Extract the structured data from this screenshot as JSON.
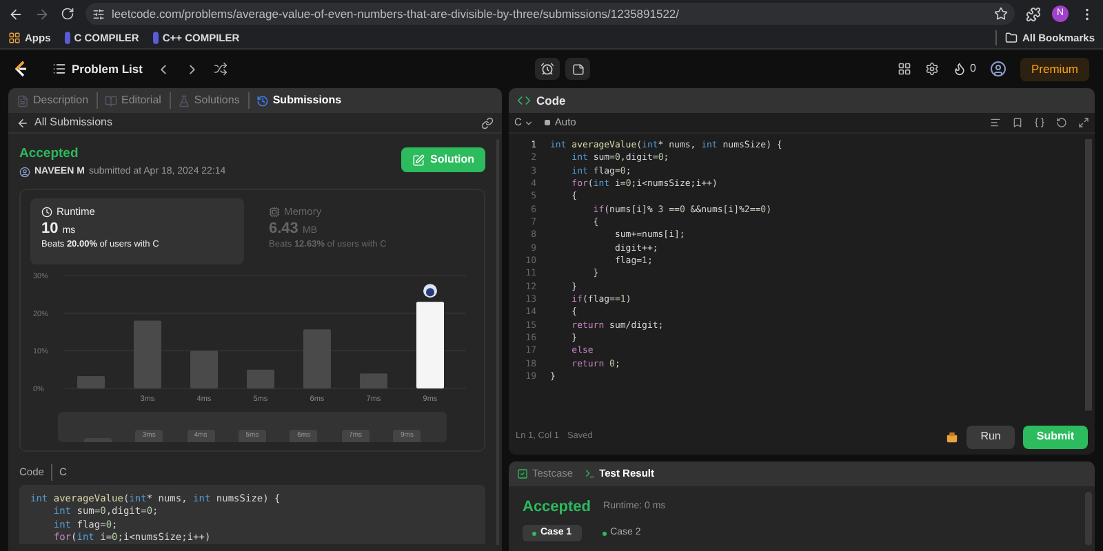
{
  "browser": {
    "url": "leetcode.com/problems/average-value-of-even-numbers-that-are-divisible-by-three/submissions/1235891522/",
    "bookmarks": [
      {
        "label": "Apps",
        "kind": "apps"
      },
      {
        "label": "C COMPILER",
        "kind": "link"
      },
      {
        "label": "C++ COMPILER",
        "kind": "link"
      }
    ],
    "all_bookmarks": "All Bookmarks",
    "profile_initial": "N"
  },
  "nav": {
    "problem_list": "Problem List",
    "streak": "0",
    "premium": "Premium"
  },
  "left_panel": {
    "tabs": [
      {
        "label": "Description",
        "selected": false
      },
      {
        "label": "Editorial",
        "selected": false
      },
      {
        "label": "Solutions",
        "selected": false
      },
      {
        "label": "Submissions",
        "selected": true
      }
    ],
    "back_link": "All Submissions",
    "submission": {
      "status": "Accepted",
      "user": "NAVEEN M",
      "submitted": "submitted at Apr 18, 2024 22:14",
      "solution_button": "Solution"
    },
    "stats": [
      {
        "kind": "runtime",
        "label": "Runtime",
        "value": "10",
        "unit": "ms",
        "beats": "Beats **20.00%** of users with C",
        "selected": true
      },
      {
        "kind": "memory",
        "label": "Memory",
        "value": "6.43",
        "unit": "MB",
        "beats": "Beats **12.63%** of users with C",
        "selected": false
      }
    ],
    "chart_data": {
      "type": "bar",
      "categories": [
        null,
        "3ms",
        "4ms",
        "5ms",
        "6ms",
        "7ms",
        "9ms"
      ],
      "series": [
        {
          "color": "#4a4a4a",
          "values": [
            3.3,
            18,
            10,
            5,
            15.7,
            4,
            null
          ]
        },
        {
          "color": "#f5f5f5",
          "values": [
            null,
            null,
            null,
            null,
            null,
            null,
            23
          ]
        }
      ],
      "ylim": [
        0,
        30
      ],
      "yticks": [
        {
          "value": 0,
          "label": "0%"
        },
        {
          "value": 10,
          "label": "10%"
        },
        {
          "value": 20,
          "label": "20%"
        },
        {
          "value": 30,
          "label": "30%"
        }
      ]
    },
    "range_labels": [
      "3ms",
      "4ms",
      "5ms",
      "6ms",
      "7ms",
      "9ms"
    ],
    "code_label": "Code",
    "code_language": "C",
    "code_lines": [
      [
        {
          "text": "int",
          "kind": "kw"
        },
        {
          "text": " averageValue",
          "kind": "fn"
        },
        {
          "text": "(",
          "kind": "p"
        },
        {
          "text": "int",
          "kind": "kw"
        },
        {
          "text": "* nums, ",
          "kind": "p"
        },
        {
          "text": "int",
          "kind": "kw"
        },
        {
          "text": " numsSize) {",
          "kind": "p"
        }
      ],
      [
        {
          "text": "    int",
          "kind": "kw"
        },
        {
          "text": " sum=",
          "kind": "p"
        },
        {
          "text": "0",
          "kind": "num"
        },
        {
          "text": ",digit=",
          "kind": "p"
        },
        {
          "text": "0",
          "kind": "num"
        },
        {
          "text": ";",
          "kind": "p"
        }
      ],
      [
        {
          "text": "    int",
          "kind": "kw"
        },
        {
          "text": " flag=",
          "kind": "p"
        },
        {
          "text": "0",
          "kind": "num"
        },
        {
          "text": ";",
          "kind": "p"
        }
      ],
      [
        {
          "text": "    for",
          "kind": "ctl"
        },
        {
          "text": "(",
          "kind": "p"
        },
        {
          "text": "int",
          "kind": "kw"
        },
        {
          "text": " i=",
          "kind": "p"
        },
        {
          "text": "0",
          "kind": "num"
        },
        {
          "text": ";i<numsSize;i++)",
          "kind": "p"
        }
      ]
    ]
  },
  "editor": {
    "title": "Code",
    "language": "C",
    "mode": "Auto",
    "lines": [
      {
        "number": "1",
        "tokens": [
          {
            "text": "int",
            "kind": "kw"
          },
          {
            "text": " averageValue",
            "kind": "fn"
          },
          {
            "text": "(",
            "kind": "p"
          },
          {
            "text": "int",
            "kind": "kw"
          },
          {
            "text": "* nums, ",
            "kind": "p"
          },
          {
            "text": "int",
            "kind": "kw"
          },
          {
            "text": " numsSize) {",
            "kind": "p"
          }
        ]
      },
      {
        "number": "2",
        "tokens": [
          {
            "text": "    int",
            "kind": "kw"
          },
          {
            "text": " sum=",
            "kind": "p"
          },
          {
            "text": "0",
            "kind": "num"
          },
          {
            "text": ",digit=",
            "kind": "p"
          },
          {
            "text": "0",
            "kind": "num"
          },
          {
            "text": ";",
            "kind": "p"
          }
        ]
      },
      {
        "number": "3",
        "tokens": [
          {
            "text": "    int",
            "kind": "kw"
          },
          {
            "text": " flag=",
            "kind": "p"
          },
          {
            "text": "0",
            "kind": "num"
          },
          {
            "text": ";",
            "kind": "p"
          }
        ]
      },
      {
        "number": "4",
        "tokens": [
          {
            "text": "    for",
            "kind": "ctl"
          },
          {
            "text": "(",
            "kind": "p"
          },
          {
            "text": "int",
            "kind": "kw"
          },
          {
            "text": " i=",
            "kind": "p"
          },
          {
            "text": "0",
            "kind": "num"
          },
          {
            "text": ";i<numsSize;i++)",
            "kind": "p"
          }
        ]
      },
      {
        "number": "5",
        "tokens": [
          {
            "text": "    {",
            "kind": "p"
          }
        ]
      },
      {
        "number": "6",
        "tokens": [
          {
            "text": "        if",
            "kind": "ctl"
          },
          {
            "text": "(nums[i]% ",
            "kind": "p"
          },
          {
            "text": "3",
            "kind": "num"
          },
          {
            "text": " ==",
            "kind": "p"
          },
          {
            "text": "0",
            "kind": "num"
          },
          {
            "text": " &&nums[i]%",
            "kind": "p"
          },
          {
            "text": "2",
            "kind": "num"
          },
          {
            "text": "==",
            "kind": "p"
          },
          {
            "text": "0",
            "kind": "num"
          },
          {
            "text": ")",
            "kind": "p"
          }
        ]
      },
      {
        "number": "7",
        "tokens": [
          {
            "text": "        {",
            "kind": "p"
          }
        ]
      },
      {
        "number": "8",
        "tokens": [
          {
            "text": "            sum+=nums[i];",
            "kind": "p"
          }
        ]
      },
      {
        "number": "9",
        "tokens": [
          {
            "text": "            digit++;",
            "kind": "p"
          }
        ]
      },
      {
        "number": "10",
        "tokens": [
          {
            "text": "            flag=",
            "kind": "p"
          },
          {
            "text": "1",
            "kind": "num"
          },
          {
            "text": ";",
            "kind": "p"
          }
        ]
      },
      {
        "number": "11",
        "tokens": [
          {
            "text": "        }",
            "kind": "p"
          }
        ]
      },
      {
        "number": "12",
        "tokens": [
          {
            "text": "    }",
            "kind": "p"
          }
        ]
      },
      {
        "number": "13",
        "tokens": [
          {
            "text": "    if",
            "kind": "ctl"
          },
          {
            "text": "(flag==",
            "kind": "p"
          },
          {
            "text": "1",
            "kind": "num"
          },
          {
            "text": ")",
            "kind": "p"
          }
        ]
      },
      {
        "number": "14",
        "tokens": [
          {
            "text": "    {",
            "kind": "p"
          }
        ]
      },
      {
        "number": "15",
        "tokens": [
          {
            "text": "    return",
            "kind": "ctl"
          },
          {
            "text": " sum/digit;",
            "kind": "p"
          }
        ]
      },
      {
        "number": "16",
        "tokens": [
          {
            "text": "    }",
            "kind": "p"
          }
        ]
      },
      {
        "number": "17",
        "tokens": [
          {
            "text": "    else",
            "kind": "ctl"
          }
        ]
      },
      {
        "number": "18",
        "tokens": [
          {
            "text": "    return",
            "kind": "ctl"
          },
          {
            "text": " 0",
            "kind": "num"
          },
          {
            "text": ";",
            "kind": "p"
          }
        ]
      },
      {
        "number": "19",
        "tokens": [
          {
            "text": "}",
            "kind": "p"
          }
        ]
      }
    ],
    "cursor": "Ln 1, Col 1",
    "saved": "Saved",
    "run": "Run",
    "submit": "Submit"
  },
  "test_panel": {
    "tabs": [
      {
        "kind": "testcase",
        "label": "Testcase",
        "selected": false
      },
      {
        "kind": "result",
        "label": "Test Result",
        "selected": true
      }
    ],
    "status": "Accepted",
    "runtime": "Runtime: 0 ms",
    "cases": [
      {
        "label": "Case 1",
        "selected": true
      },
      {
        "label": "Case 2",
        "selected": false
      }
    ]
  }
}
